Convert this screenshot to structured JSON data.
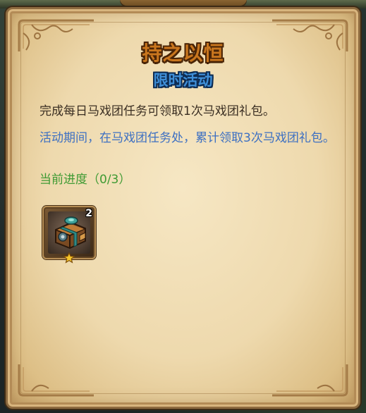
{
  "panel": {
    "title": "持之以恒",
    "subtitle": "限时活动",
    "description": "完成每日马戏团任务可领取1次马戏团礼包。",
    "note": "活动期间，在马戏团任务处，累计领取3次马戏团礼包。",
    "progress_label": "当前进度（0/3）"
  },
  "reward": {
    "icon": "circus-gift-box-icon",
    "count": "2",
    "star_icon": "star-icon"
  },
  "colors": {
    "title": "#c9761e",
    "subtitle": "#3f8fd8",
    "description": "#3a2e22",
    "note": "#3c6fc2",
    "progress": "#3e9a33",
    "parchment": "#f0dcb2"
  }
}
